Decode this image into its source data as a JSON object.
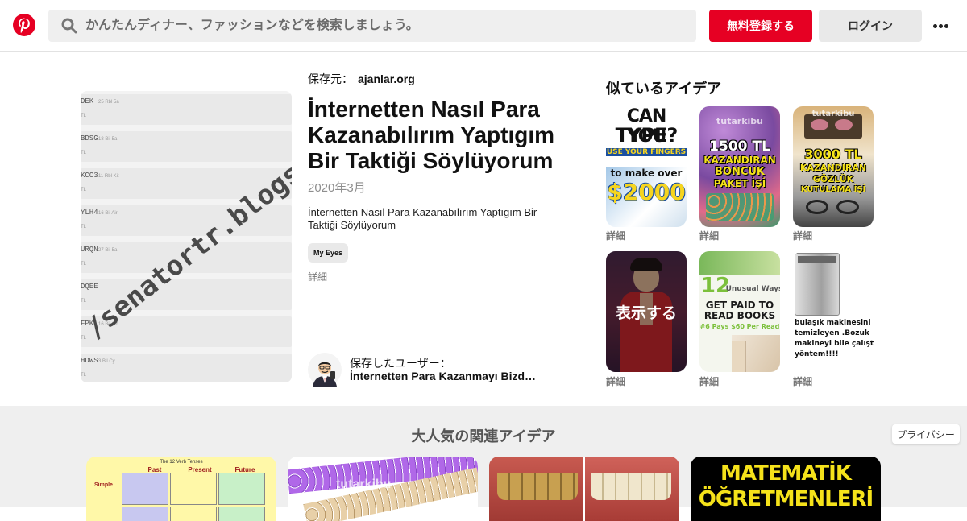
{
  "header": {
    "search_placeholder": "かんたんディナー、ファッションなどを検索しましょう。",
    "signup_label": "無料登録する",
    "login_label": "ログイン",
    "brand_color": "#e60023"
  },
  "pin": {
    "source_label": "保存元：",
    "source_domain": "ajanlar.org",
    "title": "İnternetten Nasıl Para Kazanabılırım Yaptıgım Bir Taktiği Söylüyorum",
    "date": "2020年3月",
    "description": "İnternetten Nasıl Para Kazanabılırım Yaptıgım Bir Taktiği Söylüyorum",
    "tag": "My Eyes",
    "details_link": "詳細",
    "saved_by_label": "保存したユーザー：",
    "saved_by_name": "İnternetten Para Kazanmayı Bizd…",
    "image": {
      "watermark": "/senatortr.blogspot",
      "rows": [
        {
          "code": "DEK",
          "sub": "25 Rbl 5a",
          "tl": "TL"
        },
        {
          "code": "BDSG",
          "sub": "18 Bil 5a",
          "tl": "TL"
        },
        {
          "code": "KCC3",
          "sub": "11 Rbl Kit",
          "tl": "TL"
        },
        {
          "code": "YLH4",
          "sub": "16 Bil Air",
          "tl": "TL"
        },
        {
          "code": "URQN",
          "sub": "27 Bil 5a",
          "tl": "TL"
        },
        {
          "code": "DQEE",
          "sub": "",
          "tl": "TL"
        },
        {
          "code": "FPK",
          "sub": "16 Bil Ob",
          "tl": "TL"
        },
        {
          "code": "HDWS",
          "sub": "3 Bil Cy",
          "tl": "TL"
        }
      ]
    }
  },
  "similar": {
    "title": "似ているアイデア",
    "details_label": "詳細",
    "show_label": "表示する",
    "cards": [
      {
        "lines": [
          "CAN YOU",
          "TYPE?",
          "USE YOUR FINGERS",
          "to make over",
          "$2000"
        ],
        "tag": ""
      },
      {
        "lines": [
          "1500 TL",
          "KAZANDIRAN",
          "BONCUK",
          "PAKET İŞİ"
        ],
        "tag": "tutarkibu"
      },
      {
        "lines": [
          "3000 TL",
          "KAZANDIRAN",
          "GÖZLÜK",
          "KUTULAMA İŞİ"
        ],
        "tag": "tutarkibu"
      },
      {
        "lines": [],
        "tag": ""
      },
      {
        "lines": [
          "12",
          "Unusual Ways",
          "GET PAID TO",
          "READ BOOKS",
          "#6 Pays $60 Per Read"
        ],
        "tag": ""
      },
      {
        "lines": [
          "bulaşık makinesini",
          "temizleyen .Bozuk",
          "makineyi bile çalıştıra",
          "yöntem!!!!"
        ],
        "tag": ""
      }
    ]
  },
  "related": {
    "title": "大人気の関連アイデア",
    "privacy_label": "プライバシー",
    "cards": [
      {
        "headers": [
          "The 12 Verb Tenses",
          "Past",
          "Present",
          "Future",
          "Simple"
        ]
      },
      {
        "tag": "tutarkibu"
      },
      {},
      {
        "lines": [
          "MATEMATİK",
          "ÖĞRETMENLERİ"
        ]
      }
    ]
  }
}
